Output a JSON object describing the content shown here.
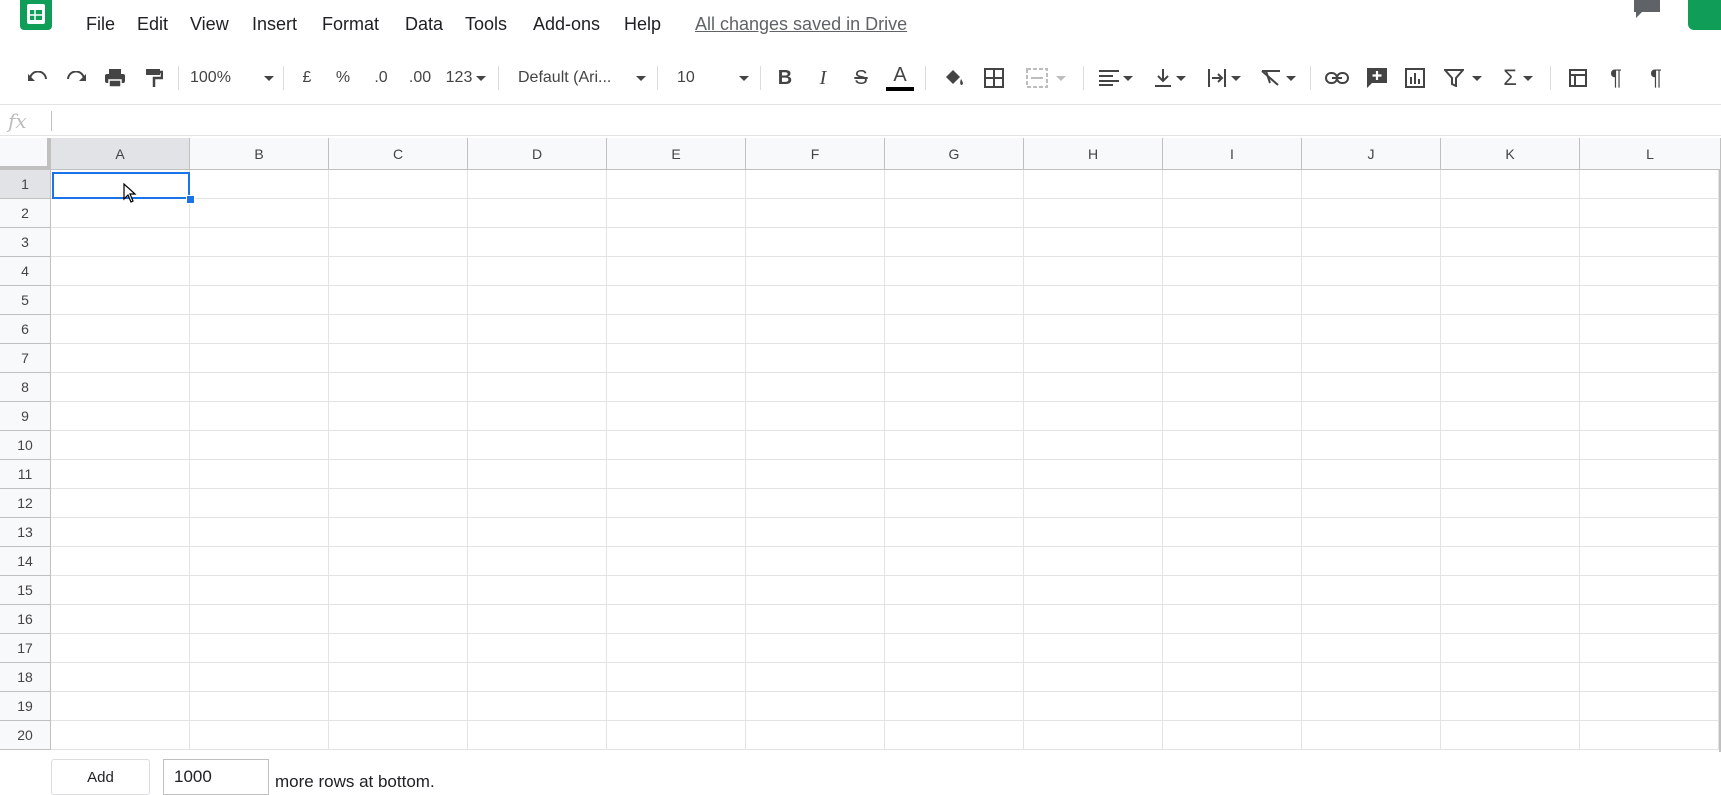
{
  "menu": {
    "items": [
      "File",
      "Edit",
      "View",
      "Insert",
      "Format",
      "Data",
      "Tools",
      "Add-ons",
      "Help"
    ],
    "save_status": "All changes saved in Drive"
  },
  "toolbar": {
    "zoom": "100%",
    "currency": "£",
    "percent": "%",
    "decrease_decimals": ".0",
    "increase_decimals": ".00",
    "more_formats": "123",
    "font_family": "Default (Ari...",
    "font_size": "10"
  },
  "formula_bar": {
    "fx_label": "fx",
    "value": ""
  },
  "grid": {
    "columns": [
      "A",
      "B",
      "C",
      "D",
      "E",
      "F",
      "G",
      "H",
      "I",
      "J",
      "K",
      "L"
    ],
    "rows": [
      "1",
      "2",
      "3",
      "4",
      "5",
      "6",
      "7",
      "8",
      "9",
      "10",
      "11",
      "12",
      "13",
      "14",
      "15",
      "16",
      "17",
      "18",
      "19",
      "20"
    ],
    "selected_cell": "A1"
  },
  "bottom": {
    "add_label": "Add",
    "rows_value": "1000",
    "suffix": "more rows at bottom."
  },
  "colors": {
    "accent": "#1a73e8",
    "brand": "#0f9d58"
  }
}
